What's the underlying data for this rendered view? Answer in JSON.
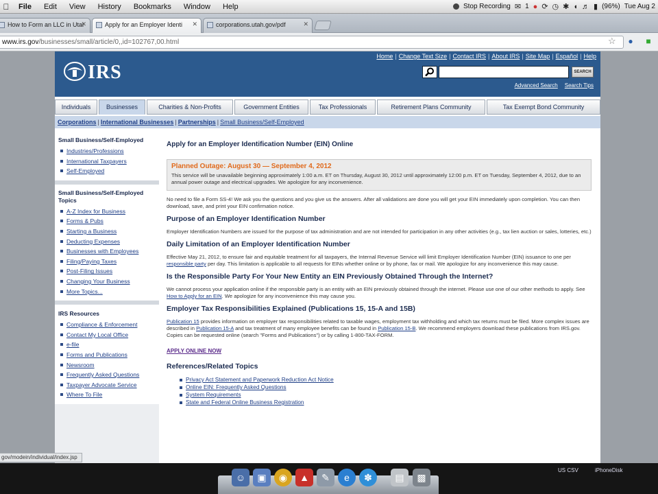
{
  "menubar": {
    "menus": [
      "File",
      "Edit",
      "View",
      "History",
      "Bookmarks",
      "Window",
      "Help"
    ],
    "stop_recording": "Stop Recording",
    "alert_count": "1",
    "battery": "(96%)",
    "clock": "Tue Aug 2"
  },
  "tabs": [
    {
      "label": "How to Form an LLC in Utah",
      "active": false
    },
    {
      "label": "Apply for an Employer Identi",
      "active": true
    },
    {
      "label": "corporations.utah.gov/pdf",
      "active": false
    }
  ],
  "urlbar": {
    "host": "www.irs.gov",
    "path": "/businesses/small/article/0,,id=102767,00.html"
  },
  "irs": {
    "logo": "IRS",
    "top_links": [
      "Home",
      "Change Text Size",
      "Contact IRS",
      "About IRS",
      "Site Map",
      "Español",
      "Help"
    ],
    "search_button": "SEARCH",
    "advanced_search": "Advanced Search",
    "search_tips": "Search Tips",
    "nav_tabs": [
      {
        "label": "Individuals",
        "w": 0
      },
      {
        "label": "Businesses",
        "w": 0
      },
      {
        "label": "Charities & Non-Profits",
        "w": 0
      },
      {
        "label": "Government Entities",
        "w": 0
      },
      {
        "label": "Tax Professionals",
        "w": 0
      },
      {
        "label": "Retirement Plans Community",
        "w": 0
      },
      {
        "label": "Tax Exempt Bond Community",
        "w": 0
      }
    ],
    "active_tab": "Businesses",
    "subnav": [
      "Corporations",
      "International Businesses",
      "Partnerships",
      "Small Business/Self-Employed"
    ]
  },
  "left": [
    {
      "heading": "Small Business/Self-Employed",
      "links": [
        "Industries/Professions",
        "International Taxpayers",
        "Self-Employed"
      ]
    },
    {
      "heading": "Small Business/Self-Employed Topics",
      "links": [
        "A-Z Index for Business",
        "Forms & Pubs",
        "Starting a Business",
        "Deducting Expenses",
        "Businesses with Employees",
        "Filing/Paying Taxes",
        "Post-Filing Issues",
        "Changing Your Business",
        "More Topics..."
      ]
    },
    {
      "heading": "IRS Resources",
      "links": [
        "Compliance & Enforcement",
        "Contact My Local Office",
        "e-file",
        "Forms and Publications",
        "Newsroom",
        "Frequently Asked Questions",
        "Taxpayer Advocate Service",
        "Where To File"
      ]
    }
  ],
  "main": {
    "title": "Apply for an Employer Identification Number (EIN) Online",
    "outage_title": "Planned Outage: August 30 — September 4, 2012",
    "outage_text": "This service will be unavailable beginning approximately 1:00 a.m. ET on Thursday, August 30, 2012 until approximately 12:00 p.m. ET on Tuesday, September 4, 2012, due to an annual power outage and electrical upgrades. We apologize for any inconvenience.",
    "intro": "No need to file a Form SS-4! We ask you the questions and you give us the answers. After all validations are done you will get your EIN immediately upon completion. You can then download, save, and print your EIN confirmation notice.",
    "h_purpose": "Purpose of an Employer Identification Number",
    "purpose": "Employer Identification Numbers are issued for the purpose of tax administration and are not intended for participation in any other activities (e.g., tax lien auction or sales, lotteries, etc.)",
    "h_daily": "Daily Limitation of an Employer Identification Number",
    "daily_1": "Effective May 21, 2012, to ensure fair and equitable treatment for all taxpayers, the Internal Revenue Service will limit Employer Identification Number (EIN) issuance to one per ",
    "daily_link": "responsible party",
    "daily_2": " per day. This limitation is applicable to all requests for EINs whether online or by phone, fax or mail.  We apologize for any inconvenience this may cause.",
    "h_responsible": "Is the Responsible Party For Your New Entity an EIN Previously Obtained Through the Internet?",
    "resp_1": "We cannot process your application online if the responsible party is an entity with an EIN previously obtained through the internet. Please use one of our other methods to apply. See ",
    "resp_link": "How to Apply for an EIN",
    "resp_2": ". We apologize for any inconvenience this may cause you.",
    "h_employer": "Employer Tax Responsibilities Explained (Publications 15, 15-A and 15B)",
    "emp_link1": "Publication 15",
    "emp_1": " provides information on employer tax responsibilities related to taxable wages, employment tax withholding and which tax returns must be filed.  More complex issues are described in ",
    "emp_link2": "Publication 15-A",
    "emp_2": " and tax treatment of many employee benefits can be found in ",
    "emp_link3": "Publication 15-B",
    "emp_3": ". We recommend employers download these publications from IRS.gov.  Copies can be requested online (search \"Forms and Publications\") or by calling 1-800-TAX-FORM.",
    "apply_online": "APPLY ONLINE NOW",
    "h_refs": "References/Related Topics",
    "refs": [
      "Privacy Act Statement and Paperwork Reduction Act Notice",
      "Online EIN: Frequently Asked Questions",
      "System Requirements",
      "State and Federal Online Business Registration"
    ]
  },
  "status_url": "gov/modein/individual/index.jsp",
  "desktop": {
    "label1": "US CSV",
    "label2": "iPhoneDisk"
  }
}
